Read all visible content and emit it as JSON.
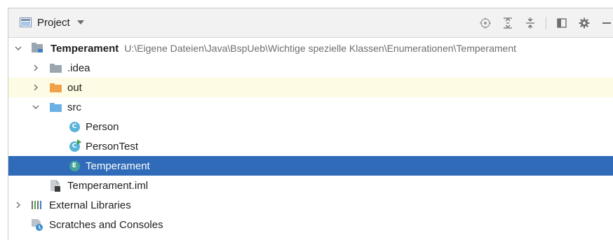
{
  "toolbar": {
    "project_label": "Project",
    "icons": [
      "locate-icon",
      "expand-all-icon",
      "collapse-all-icon",
      "layout-icon",
      "gear-icon",
      "hide-icon"
    ]
  },
  "tree": {
    "root": {
      "name": "Temperament",
      "path": "U:\\Eigene Dateien\\Java\\BspUeb\\Wichtige spezielle Klassen\\Enumerationen\\Temperament"
    },
    "idea": ".idea",
    "out": "out",
    "src": "src",
    "person": "Person",
    "person_test": "PersonTest",
    "temperament_enum": "Temperament",
    "iml": "Temperament.iml",
    "ext_libs": "External Libraries",
    "scratches": "Scratches and Consoles"
  },
  "badges": {
    "class": "C",
    "enum": "E"
  },
  "colors": {
    "selection": "#2f6bb8",
    "hover_row": "#fdfbe3",
    "folder_out": "#f0a24b",
    "folder_src": "#6cb1e6"
  }
}
